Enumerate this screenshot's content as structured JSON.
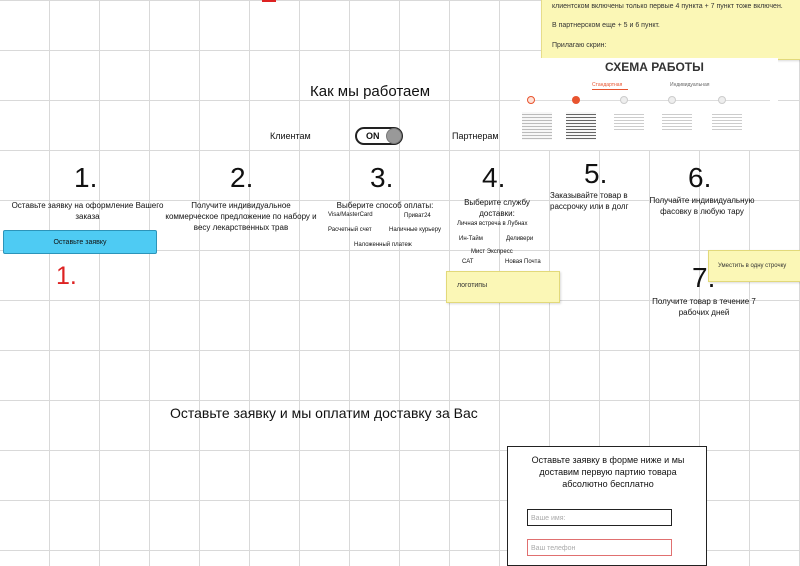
{
  "top_note": {
    "line1": "клиентском включены только первые 4 пункта + 7 пункт тоже включен.",
    "line2": "В партнерском еще + 5 и 6 пункт.",
    "line3": "Прилагаю скрин:"
  },
  "scheme": {
    "title": "СХЕМА РАБОТЫ",
    "tab_standard": "Стандартная",
    "tab_individual": "Индивидуальная",
    "accent_color": "#e8542f"
  },
  "section_title": "Как мы работаем",
  "toggle": {
    "left_label": "Клиентам",
    "state_label": "ON",
    "right_label": "Партнерам"
  },
  "steps": [
    {
      "number": "1.",
      "text": "Оставьте заявку на оформление Вашего заказа"
    },
    {
      "number": "2.",
      "text": "Получите индивидуальное коммерческое предложение по набору и весу лекарственных трав"
    },
    {
      "number": "3.",
      "text": "Выберите способ оплаты:"
    },
    {
      "number": "4.",
      "text": "Выберите службу доставки:"
    },
    {
      "number": "5.",
      "text": "Заказывайте товар в рассрочку или в долг"
    },
    {
      "number": "6.",
      "text": "Получайте индивидуальную фасовку в любую тару"
    },
    {
      "number": "7.",
      "text": "Получите товар в течение 7 рабочих дней"
    }
  ],
  "payment_methods": [
    "Visa/MasterCard",
    "Приват24",
    "Расчетный счет",
    "Наличные курьеру",
    "Наложенный платеж"
  ],
  "delivery_services": [
    "Личная встреча в Лубнах",
    "Ин-Тайм",
    "Деливери",
    "Мист Экспресс",
    "САТ",
    "Новая Почта"
  ],
  "order_button": "Оставьте заявку",
  "red_mark": "1.",
  "sticky_logos": "логотипы",
  "sticky_right": "Уместить в одну строчку",
  "cta_title": "Оставьте заявку и мы оплатим доставку за Вас",
  "form": {
    "text": "Оставьте заявку в форме ниже и мы доставим первую партию товара абсолютно бесплатно",
    "name_placeholder": "Ваше имя:",
    "phone_placeholder": "Ваш телефон"
  }
}
